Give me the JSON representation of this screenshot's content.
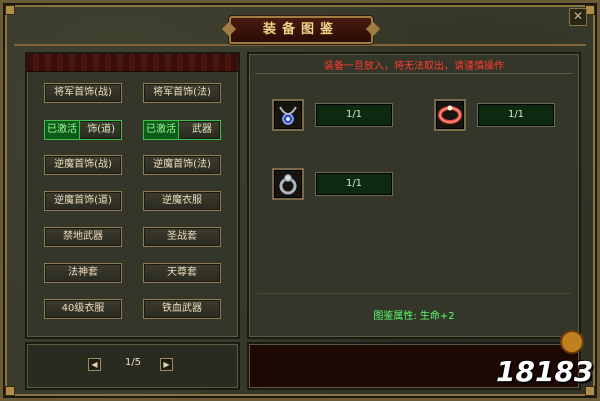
{
  "window": {
    "title": "装备图鉴",
    "close_glyph": "✕"
  },
  "left_panel": {
    "buttons": [
      {
        "label": "将军首饰(战)",
        "active": false
      },
      {
        "label": "将军首饰(法)",
        "active": false
      },
      {
        "label": "将军首饰(道)",
        "active": true,
        "badge": "已激活",
        "visible_tail": "饰(道)"
      },
      {
        "label": "将军武器",
        "active": true,
        "badge": "已激活",
        "visible_tail": "武器"
      },
      {
        "label": "逆魔首饰(战)",
        "active": false
      },
      {
        "label": "逆魔首饰(法)",
        "active": false
      },
      {
        "label": "逆魔首饰(道)",
        "active": false
      },
      {
        "label": "逆魔衣服",
        "active": false
      },
      {
        "label": "禁地武器",
        "active": false
      },
      {
        "label": "圣战套",
        "active": false
      },
      {
        "label": "法神套",
        "active": false
      },
      {
        "label": "天尊套",
        "active": false
      },
      {
        "label": "40级衣服",
        "active": false
      },
      {
        "label": "铁血武器",
        "active": false
      }
    ]
  },
  "pager": {
    "prev_glyph": "◀",
    "next_glyph": "▶",
    "page": "1/5"
  },
  "right_panel": {
    "warning": "装备一旦放入，将无法取出，请谨慎操作",
    "items": [
      {
        "icon": "necklace-icon",
        "count": "1/1",
        "accent": "#3a6ad8"
      },
      {
        "icon": "bracelet-icon",
        "count": "1/1",
        "accent": "#d04a3a"
      },
      {
        "icon": "ring-icon",
        "count": "1/1",
        "accent": "#9aa0a8"
      }
    ],
    "attribute": "图鉴属性: 生命+2"
  },
  "watermark": "18183",
  "colors": {
    "active_green": "#3cc04a",
    "warning_red": "#ff3a2a",
    "attr_green": "#5cff6a",
    "title_gold": "#f2d48a"
  }
}
